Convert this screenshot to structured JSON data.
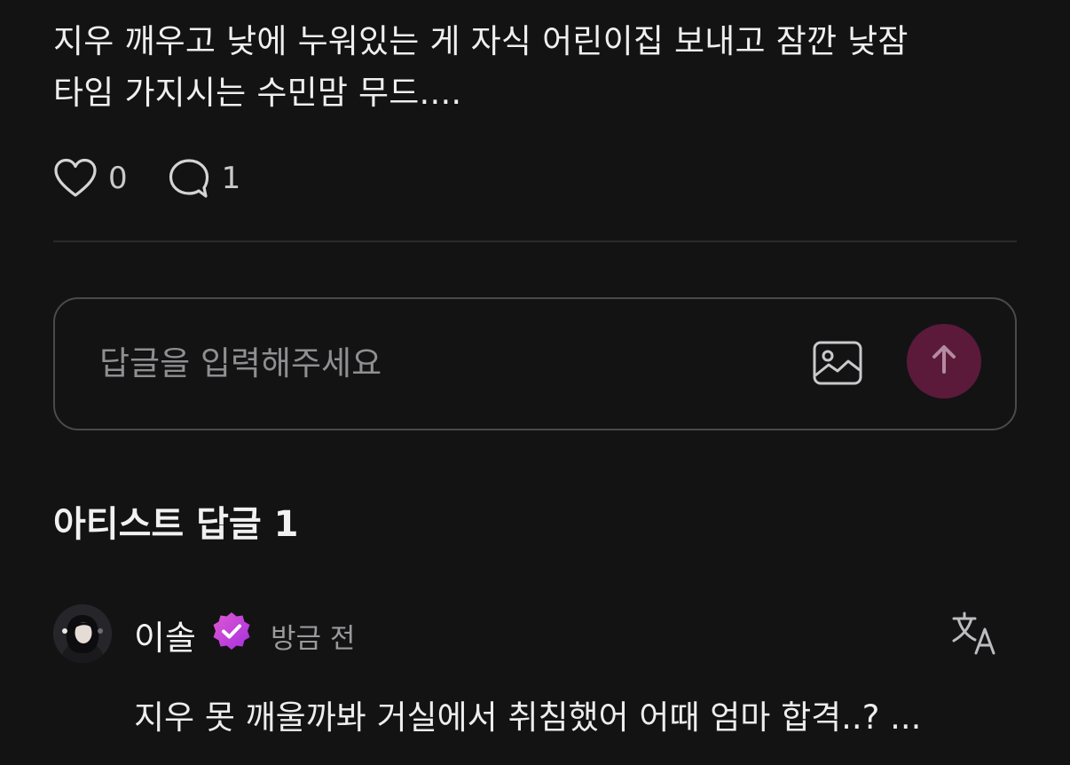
{
  "post": {
    "line1": "지우 깨우고 낮에 누워있는 게 자식 어린이집 보내고 잠깐 낮잠",
    "line2": "타임 가지시는 수민맘 무드...."
  },
  "actions": {
    "like_icon": "heart-outline-icon",
    "like_count": "0",
    "comment_icon": "speech-bubble-icon",
    "comment_count": "1"
  },
  "reply": {
    "placeholder": "답글을 입력해주세요",
    "value": "",
    "image_icon": "image-icon",
    "send_icon": "arrow-up-icon",
    "send_color": "#5b1a3a"
  },
  "artist_replies": {
    "title": "아티스트 답글 1",
    "comments": [
      {
        "name": "이솔",
        "badge_icon": "verified-badge-icon",
        "badge_color": "#c940e0",
        "time": "방금 전",
        "translate_icon": "translate-icon",
        "text": "지우 못 깨울까봐 거실에서 취침했어 어때 엄마 합격..? ..."
      }
    ]
  }
}
